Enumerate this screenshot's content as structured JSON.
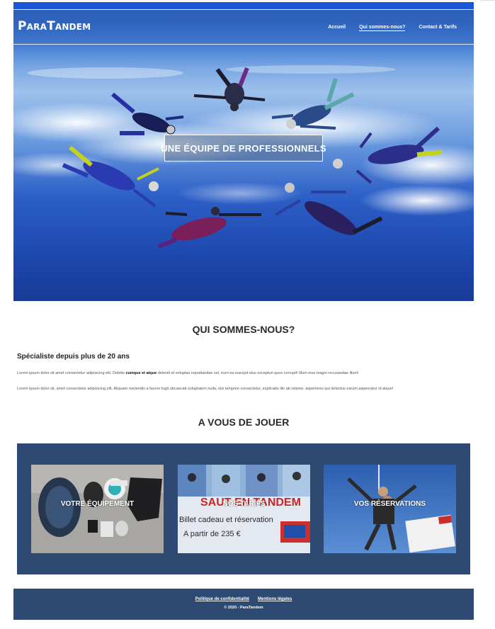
{
  "site": {
    "brand": "ParaTandem",
    "nav": [
      {
        "label": "Accueil",
        "active": false
      },
      {
        "label": "Qui sommes-nous?",
        "active": true
      },
      {
        "label": "Contact & Tarifs",
        "active": false
      }
    ]
  },
  "hero": {
    "title": "UNE ÉQUIPE DE PROFESSIONNELS"
  },
  "about": {
    "heading": "QUI SOMMES-NOUS?",
    "subheading": "Spécialiste depuis plus de 20 ans",
    "para1_start": "Lorem ipsum dolor sit amet consectetur adipisicing elit. Debitis ",
    "para1_bold": "cumque et atque",
    "para1_end": " deleniti et voluptas repudiandae vel, eum ea suscipit eius excepturi quos corrupti! Illum eius magni recusandae illum!",
    "para2": "Lorem ipsum dolor sit, amet consectetur adipisicing elit. Aliquam reiciendis a facere fugit obcaecati voluptatem nulla, nisi tempore consectetur, explicabo illo ab ratione, asperiores qui delectus earum aspernatur id atque!"
  },
  "play": {
    "heading": "A VOUS DE JOUER",
    "cards": [
      {
        "label": "VOTRE ÉQUIPEMENT"
      },
      {
        "label": "NOS TARIFS",
        "image_text_top": "SAUT EN TANDEM",
        "image_text_1": "Billet cadeau et réservation",
        "image_text_2": "A partir de 235 €"
      },
      {
        "label": "VOS RÉSERVATIONS"
      }
    ]
  },
  "footer": {
    "links": [
      "Politique de confidentialité",
      "Mentions légales"
    ],
    "copyright": "© 2020 - ParaTandem"
  },
  "colors": {
    "panel": "#2e4a73",
    "accent": "#1b56d8"
  }
}
